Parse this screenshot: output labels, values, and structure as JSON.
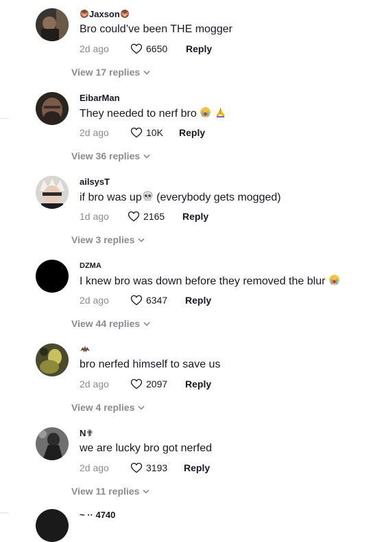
{
  "comments": [
    {
      "username": "Jaxson",
      "user_emoji": "monkey-face-emoji",
      "text": "Bro could’ve been THE mogger",
      "date": "2d ago",
      "likes": "6650",
      "reply_label": "Reply",
      "view_replies": "View 17 replies"
    },
    {
      "username": "EibarMan",
      "text": "They needed to nerf bro",
      "text_emojis": [
        "crying-face-emoji",
        "praying-hands-emoji"
      ],
      "date": "2d ago",
      "likes": "10K",
      "reply_label": "Reply",
      "view_replies": "View 36 replies"
    },
    {
      "username": "ailsysT",
      "text_before": "if bro was up",
      "text_emoji": "skull-emoji",
      "text_after": " (everybody gets mogged)",
      "date": "1d ago",
      "likes": "2165",
      "reply_label": "Reply",
      "view_replies": "View 3 replies"
    },
    {
      "username": "DZMA",
      "text": "I knew bro was down before they removed the blur",
      "text_emoji": "crying-face-emoji",
      "date": "2d ago",
      "likes": "6347",
      "reply_label": "Reply",
      "view_replies": "View 44 replies"
    },
    {
      "username_emoji": "bat-emoji",
      "text": "bro nerfed himself to save us",
      "date": "2d ago",
      "likes": "2097",
      "reply_label": "Reply",
      "view_replies": "View 4 replies"
    },
    {
      "username": "N",
      "username_suffix": "✟",
      "text": "we are lucky bro got nerfed",
      "date": "2d ago",
      "likes": "3193",
      "reply_label": "Reply",
      "view_replies": "View 11 replies"
    }
  ],
  "next_comment": {
    "username": "~ ·· 4740"
  },
  "colors": {
    "text": "#161823",
    "muted": "#8a8b91"
  }
}
